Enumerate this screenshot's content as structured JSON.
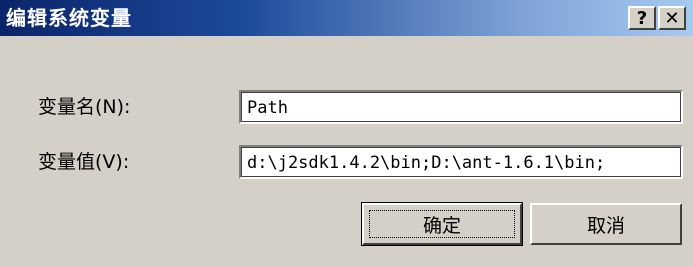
{
  "window": {
    "title": "编辑系统变量",
    "help_label": "?",
    "close_label": "✕"
  },
  "form": {
    "name_label": "变量名(N):",
    "name_value": "Path",
    "value_label": "变量值(V):",
    "value_value": "d:\\j2sdk1.4.2\\bin;D:\\ant-1.6.1\\bin;"
  },
  "buttons": {
    "ok_label": "确定",
    "cancel_label": "取消"
  },
  "colors": {
    "titlebar_start": "#0a246a",
    "titlebar_end": "#a6caf0",
    "dialog_bg": "#d4d0c8"
  }
}
